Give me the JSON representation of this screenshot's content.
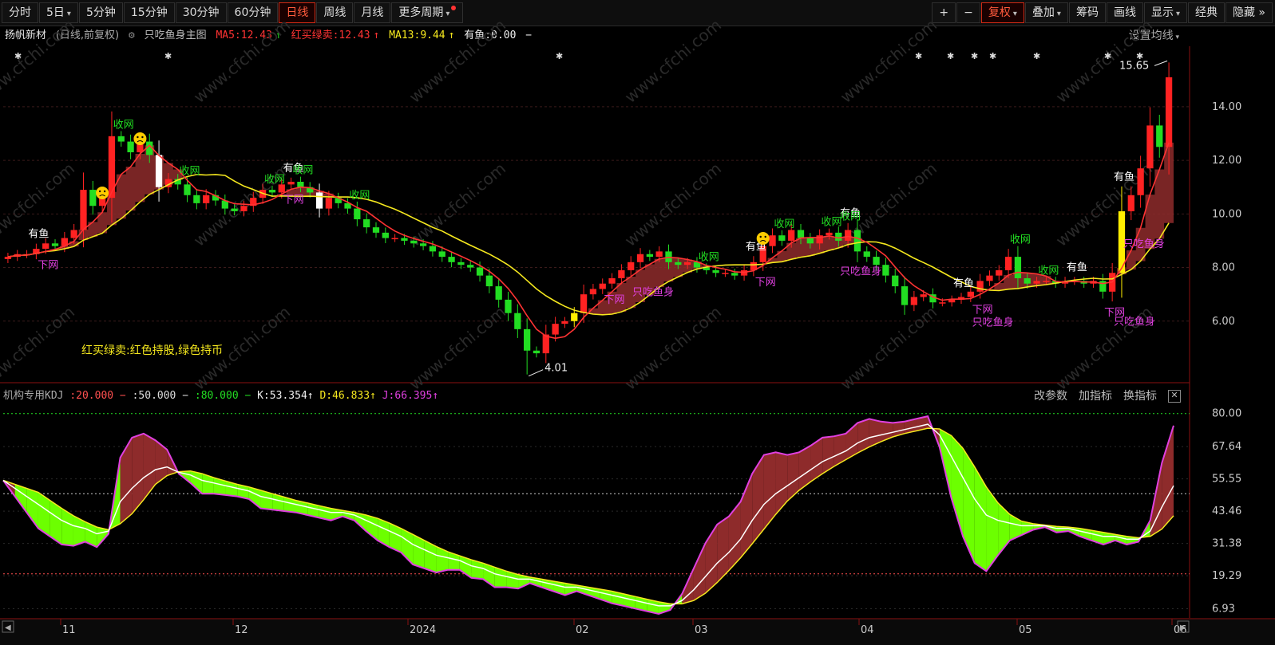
{
  "toolbar": {
    "periods": [
      "分时",
      "5日",
      "5分钟",
      "15分钟",
      "30分钟",
      "60分钟",
      "日线",
      "周线",
      "月线",
      "更多周期"
    ],
    "active_period": "日线",
    "right_buttons": [
      "+",
      "−",
      "复权",
      "叠加",
      "筹码",
      "画线",
      "显示",
      "经典",
      "隐藏"
    ]
  },
  "info": {
    "stock_name": "扬帆新材",
    "mode": "(日线,前复权)",
    "main_indicator": "只吃鱼身主图",
    "ma5": "MA5:12.43",
    "hmlm": "红买绿卖:12.43",
    "ma13": "MA13:9.44",
    "yuyu": "有鱼:0.00",
    "dash": "−",
    "set_ma": "设置均线"
  },
  "chart_data": [
    {
      "type": "candlestick",
      "title": "扬帆新材",
      "price_axis_ticks": [
        "6.00",
        "8.00",
        "10.00",
        "12.00",
        "14.00"
      ],
      "ylim": [
        4.0,
        15.9
      ],
      "date_labels": [
        "11",
        "12",
        "2024",
        "02",
        "03",
        "04",
        "05",
        "06"
      ],
      "high_label": "15.65",
      "low_label": "4.01",
      "legend_note": "红买绿卖:红色持股,绿色持币",
      "signals": [
        {
          "text": "有鱼",
          "i": 3
        },
        {
          "text": "下网",
          "i": 4
        },
        {
          "text": "收网",
          "i": 12
        },
        {
          "text": "收网",
          "i": 19
        },
        {
          "text": "收网",
          "i": 28
        },
        {
          "text": "有鱼",
          "i": 30
        },
        {
          "text": "收网",
          "i": 31
        },
        {
          "text": "下网",
          "i": 30
        },
        {
          "text": "收网",
          "i": 37
        },
        {
          "text": "下网",
          "i": 64
        },
        {
          "text": "只吃鱼身",
          "i": 67
        },
        {
          "text": "收网",
          "i": 74
        },
        {
          "text": "有鱼",
          "i": 79
        },
        {
          "text": "下网",
          "i": 80
        },
        {
          "text": "收网",
          "i": 82
        },
        {
          "text": "收网",
          "i": 87
        },
        {
          "text": "只吃鱼身",
          "i": 89
        },
        {
          "text": "有鱼",
          "i": 89
        },
        {
          "text": "收网",
          "i": 89
        },
        {
          "text": "有鱼",
          "i": 101
        },
        {
          "text": "下网",
          "i": 103
        },
        {
          "text": "只吃鱼身",
          "i": 103
        },
        {
          "text": "收网",
          "i": 107
        },
        {
          "text": "收网",
          "i": 110
        },
        {
          "text": "有鱼",
          "i": 113
        },
        {
          "text": "下网",
          "i": 117
        },
        {
          "text": "只吃鱼身",
          "i": 118
        },
        {
          "text": "有鱼",
          "i": 118
        },
        {
          "text": "只吃鱼身",
          "i": 119
        }
      ],
      "close": [
        8.4,
        8.5,
        8.5,
        8.7,
        8.9,
        8.8,
        9.1,
        9.4,
        10.9,
        10.3,
        10.6,
        12.9,
        12.7,
        12.3,
        12.7,
        12.2,
        11.0,
        11.3,
        11.1,
        10.7,
        10.4,
        10.7,
        10.5,
        10.2,
        10.1,
        10.3,
        10.6,
        10.9,
        10.8,
        11.1,
        11.2,
        11.0,
        10.8,
        10.2,
        10.6,
        10.4,
        10.2,
        9.8,
        9.5,
        9.3,
        9.1,
        9.1,
        9.0,
        8.9,
        8.8,
        8.6,
        8.4,
        8.2,
        8.1,
        8.0,
        7.7,
        7.3,
        6.8,
        6.3,
        5.7,
        4.9,
        4.8,
        5.5,
        5.9,
        6.0,
        6.3,
        7.0,
        7.2,
        7.4,
        7.6,
        7.9,
        8.2,
        8.5,
        8.4,
        8.6,
        8.2,
        8.1,
        8.2,
        8.0,
        7.9,
        7.8,
        7.8,
        7.7,
        7.9,
        8.2,
        8.8,
        9.2,
        9.0,
        9.4,
        9.1,
        8.9,
        9.2,
        9.3,
        9.0,
        9.4,
        8.6,
        8.4,
        8.1,
        7.7,
        7.3,
        6.6,
        6.9,
        7.0,
        6.7,
        6.7,
        6.8,
        6.9,
        7.1,
        7.5,
        7.7,
        7.9,
        8.4,
        7.6,
        7.4,
        7.5,
        7.5,
        7.4,
        7.5,
        7.5,
        7.4,
        7.5,
        7.1,
        7.8,
        10.1,
        10.7,
        11.7,
        13.3,
        12.5,
        15.1
      ],
      "ma5_last": 12.43,
      "ma13_last": 9.44
    },
    {
      "type": "line",
      "title": "机构专用KDJ",
      "series_labels": [
        ":20.000",
        ":50.000",
        ":80.000",
        "K:53.354",
        "D:46.833",
        "J:66.395"
      ],
      "y_axis_ticks": [
        "80.00",
        "67.64",
        "55.55",
        "43.46",
        "31.38",
        "19.29",
        "6.93"
      ],
      "ylim": [
        5.0,
        82.0
      ],
      "K": [
        55,
        52,
        49,
        46,
        43,
        40,
        38,
        37,
        35,
        36,
        47,
        52,
        56,
        59,
        60,
        58,
        57,
        55,
        54,
        53,
        52,
        51,
        49,
        48,
        47,
        46,
        45,
        44,
        43,
        43,
        42,
        40,
        38,
        36,
        34,
        31,
        29,
        27,
        26,
        25,
        23,
        22,
        20,
        19,
        18,
        18,
        17,
        16,
        15,
        15,
        14,
        13,
        12,
        11,
        10,
        9,
        8,
        8,
        10,
        14,
        19,
        24,
        28,
        33,
        40,
        46,
        50,
        53,
        56,
        59,
        62,
        64,
        66,
        69,
        71,
        72,
        73,
        74,
        75,
        76,
        72,
        64,
        56,
        48,
        42,
        40,
        39,
        38,
        38,
        38,
        37,
        37,
        36,
        35,
        34,
        34,
        33,
        33,
        36,
        45,
        53
      ]
    }
  ],
  "kdj": {
    "name": "机构专用KDJ",
    "p20": ":20.000",
    "p50": ":50.000",
    "p80": ":80.000",
    "k": "K:53.354",
    "d": "D:46.833",
    "j": "J:66.395",
    "tools": [
      "改参数",
      "加指标",
      "换指标"
    ]
  },
  "colors": {
    "up": "#ff2222",
    "down": "#22dd22",
    "ma5": "#ff3333",
    "ma13": "#f5e81e",
    "fish_fill": "#8e2b2b",
    "kdj_green": "#6cff00",
    "kdj_red": "#8e2b2b",
    "kdj_j": "#e040e0"
  }
}
